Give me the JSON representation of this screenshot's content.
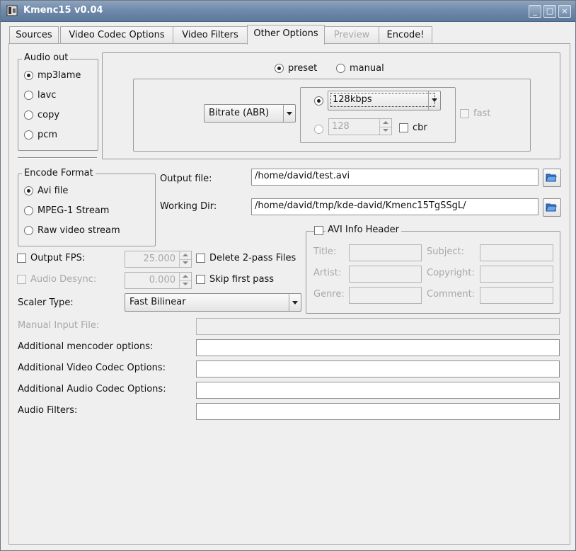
{
  "window": {
    "title": "Kmenc15 v0.04",
    "buttons": [
      "_",
      "□",
      "×"
    ]
  },
  "tabs": [
    {
      "label": "Sources",
      "state": "normal"
    },
    {
      "label": "Video Codec Options",
      "state": "normal"
    },
    {
      "label": "Video Filters",
      "state": "normal"
    },
    {
      "label": "Other Options",
      "state": "active"
    },
    {
      "label": "Preview",
      "state": "disabled"
    },
    {
      "label": "Encode!",
      "state": "normal"
    }
  ],
  "audio_out": {
    "title": "Audio out",
    "options": [
      {
        "label": "mp3lame",
        "selected": true
      },
      {
        "label": "lavc",
        "selected": false
      },
      {
        "label": "copy",
        "selected": false
      },
      {
        "label": "pcm",
        "selected": false
      }
    ]
  },
  "mp3": {
    "preset_label": "preset",
    "manual_label": "manual",
    "mode": "preset",
    "bitrate_mode": "Bitrate (ABR)",
    "bitrate_value": "128kbps",
    "bitrate_spin": "128",
    "cbr_label": "cbr",
    "fast_label": "fast"
  },
  "encode_format": {
    "title": "Encode Format",
    "options": [
      {
        "label": "Avi file",
        "selected": true
      },
      {
        "label": "MPEG-1 Stream",
        "selected": false
      },
      {
        "label": "Raw video stream",
        "selected": false
      }
    ]
  },
  "output": {
    "output_file_label": "Output file:",
    "output_file_value": "/home/david/test.avi",
    "working_dir_label": "Working Dir:",
    "working_dir_value": "/home/david/tmp/kde-david/Kmenc15TgSSgL/"
  },
  "fps": {
    "output_fps_label": "Output FPS:",
    "output_fps_value": "25.000",
    "audio_desync_label": "Audio Desync:",
    "audio_desync_value": "0.000",
    "delete_2pass_label": "Delete 2-pass Files",
    "skip_first_label": "Skip first pass"
  },
  "avi_info": {
    "title": "AVI Info Header",
    "fields": [
      "Title:",
      "Subject:",
      "Artist:",
      "Copyright:",
      "Genre:",
      "Comment:"
    ]
  },
  "scaler": {
    "label": "Scaler Type:",
    "value": "Fast Bilinear"
  },
  "extra": {
    "manual_input_label": "Manual Input File:",
    "mencoder_label": "Additional mencoder options:",
    "video_codec_label": "Additional Video Codec Options:",
    "audio_codec_label": "Additional Audio Codec Options:",
    "audio_filters_label": "Audio Filters:"
  }
}
